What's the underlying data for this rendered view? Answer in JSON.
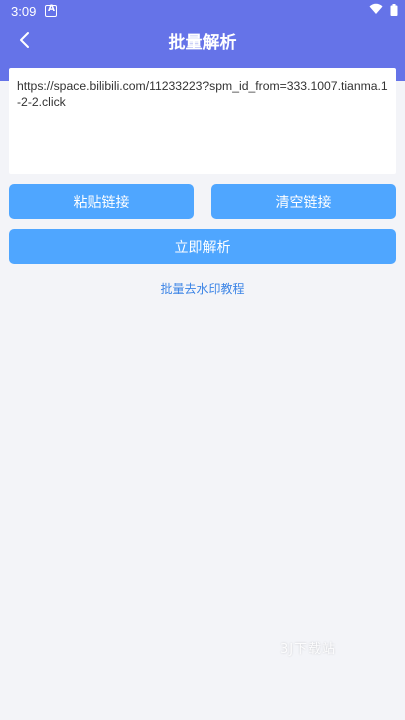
{
  "status_bar": {
    "time": "3:09"
  },
  "header": {
    "title": "批量解析",
    "back_icon": "chevron-left-icon"
  },
  "url_input": {
    "value": "https://space.bilibili.com/11233223?spm_id_from=333.1007.tianma.1-2-2.click"
  },
  "buttons": {
    "paste_label": "粘贴链接",
    "clear_label": "清空链接",
    "parse_label": "立即解析"
  },
  "tutorial_link": "批量去水印教程",
  "watermark": "3J下载站",
  "colors": {
    "header_bg": "#6573e8",
    "button_bg": "#4fa6ff",
    "link": "#3b84e6",
    "page_bg": "#f3f4f8"
  }
}
